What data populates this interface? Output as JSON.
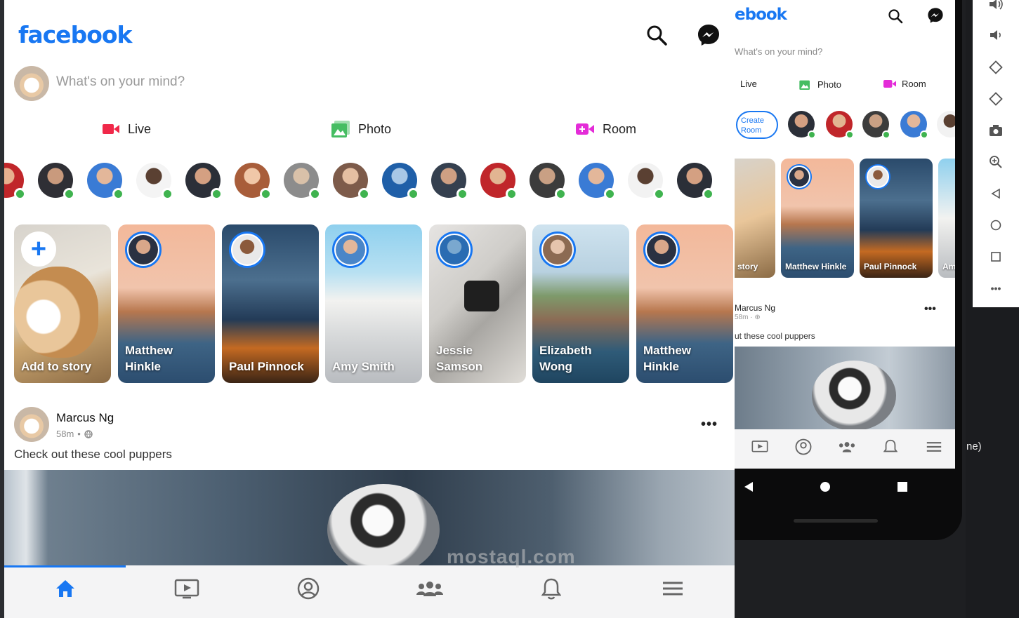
{
  "app": {
    "logo": "facebook",
    "composer_placeholder": "What's on your mind?",
    "actions": [
      {
        "label": "Live",
        "color": "#f02849"
      },
      {
        "label": "Photo",
        "color": "#45bd62"
      },
      {
        "label": "Room",
        "color": "#e42cd8"
      }
    ],
    "stories": [
      {
        "name": "Add to story"
      },
      {
        "name": "Matthew Hinkle"
      },
      {
        "name": "Paul Pinnock"
      },
      {
        "name": "Amy Smith"
      },
      {
        "name": "Jessie Samson"
      },
      {
        "name": "Elizabeth Wong"
      },
      {
        "name": "Matthew Hinkle"
      }
    ],
    "post": {
      "author": "Marcus Ng",
      "time": "58m",
      "text": "Check out these cool puppers"
    },
    "nav_icons": [
      "home-icon",
      "watch-icon",
      "profile-icon",
      "groups-icon",
      "notifications-icon",
      "menu-icon"
    ],
    "accent": "#1877f2",
    "online_color": "#3fb34f"
  },
  "phone": {
    "logo_partial": "ebook",
    "composer_placeholder": "What's on your mind?",
    "actions": [
      "Live",
      "Photo",
      "Room"
    ],
    "create_room": "Create Room",
    "stories": [
      {
        "name": "story"
      },
      {
        "name": "Matthew Hinkle"
      },
      {
        "name": "Paul Pinnock"
      },
      {
        "name": "Am"
      }
    ],
    "post": {
      "author": "Marcus Ng",
      "meta": "58m · ⊕",
      "text": "ut these cool puppers"
    }
  },
  "background": {
    "right_text": "ne)"
  },
  "watermark": "mostaql.com"
}
